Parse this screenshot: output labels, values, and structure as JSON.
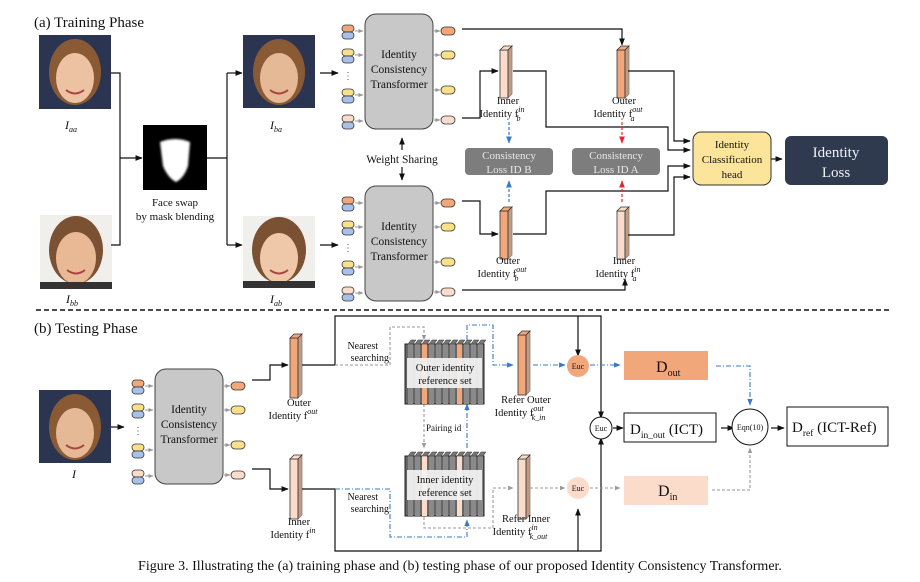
{
  "training": {
    "title": "(a) Training Phase",
    "faces": {
      "aa": {
        "label": "I",
        "sub": "aa"
      },
      "bb": {
        "label": "I",
        "sub": "bb"
      },
      "ba": {
        "label": "I",
        "sub": "ba"
      },
      "ab": {
        "label": "I",
        "sub": "ab"
      }
    },
    "mask_caption": [
      "Face swap",
      "by mask blending"
    ],
    "transformer_label": [
      "Identity",
      "Consistency",
      "Transformer"
    ],
    "weight_sharing": "Weight Sharing",
    "inner_b": {
      "line1": "Inner",
      "line2": "Identity f",
      "sup": "in",
      "sub": "b"
    },
    "outer_a": {
      "line1": "Outer",
      "line2": "Identity f",
      "sup": "out",
      "sub": "a"
    },
    "outer_b": {
      "line1": "Outer",
      "line2": "Identity f",
      "sup": "out",
      "sub": "b"
    },
    "inner_a": {
      "line1": "Inner",
      "line2": "Identity f",
      "sup": "in",
      "sub": "a"
    },
    "loss_b": [
      "Consistency",
      "Loss ID B"
    ],
    "loss_a": [
      "Consistency",
      "Loss ID A"
    ],
    "cls_head": [
      "Identity",
      "Classification",
      "head"
    ],
    "identity_loss": [
      "Identity",
      "Loss"
    ]
  },
  "testing": {
    "title": "(b) Testing Phase",
    "face": {
      "label": "I"
    },
    "transformer_label": [
      "Identity",
      "Consistency",
      "Transformer"
    ],
    "outer": {
      "line1": "Outer",
      "line2": "Identity f",
      "sup": "out"
    },
    "inner": {
      "line1": "Inner",
      "line2": "Identity f",
      "sup": "in"
    },
    "nearest_top": [
      "Nearest",
      "searching"
    ],
    "nearest_bottom": [
      "Nearest",
      "searching"
    ],
    "outer_ref_set": [
      "Outer identity",
      "reference set"
    ],
    "inner_ref_set": [
      "Inner identity",
      "reference set"
    ],
    "pairing": "Pairing id",
    "refer_outer": {
      "line1": "Refer Outer",
      "line2": "Identity f",
      "sup": "out",
      "sub": "k_in"
    },
    "refer_inner": {
      "line1": "Refer Inner",
      "line2": "Identity f",
      "sup": "in",
      "sub": "k_out"
    },
    "euc": "Euc",
    "d_out": {
      "main": "D",
      "sub": "out"
    },
    "d_in": {
      "main": "D",
      "sub": "in"
    },
    "d_in_out": {
      "main": "D",
      "sub": "in_out",
      "suffix": " (ICT)"
    },
    "eqn": "Eqn(10)",
    "d_ref": {
      "main": "D",
      "sub": "ref",
      "suffix": " (ICT-Ref)"
    }
  },
  "caption": "Figure 3. Illustrating the (a) training phase and (b) testing phase of our proposed Identity Consistency Transformer.",
  "colors": {
    "orange": "#f2a77a",
    "orange_dark": "#c9713f",
    "yellow": "#fbe08a",
    "peach": "#fbdccb",
    "blue_token": "#a9c1e8",
    "transformer_gray": "#c8c8c8",
    "loss_gray": "#7d7d7d",
    "cls_yellow": "#fce59a",
    "loss_dark": "#2f3a4e",
    "arrow_blue": "#3a78c9",
    "arrow_red": "#e8232b"
  }
}
